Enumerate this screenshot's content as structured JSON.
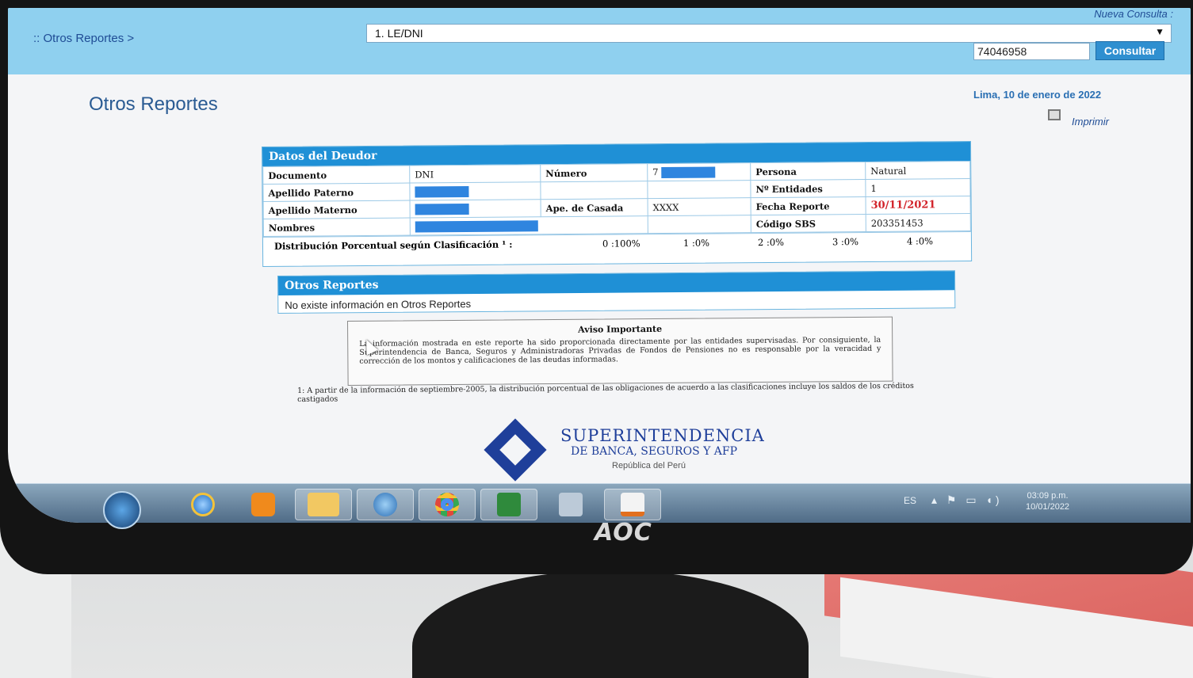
{
  "topbar": {
    "breadcrumb": ":: Otros Reportes >",
    "nueva_consulta": "Nueva Consulta :",
    "document_type": "1. LE/DNI",
    "document_number": "74046958",
    "consultar_label": "Consultar"
  },
  "page": {
    "title": "Otros Reportes",
    "date": "Lima, 10 de enero de 2022",
    "print_label": "Imprimir"
  },
  "deudor": {
    "header": "Datos del Deudor",
    "labels": {
      "documento": "Documento",
      "numero": "Número",
      "persona": "Persona",
      "entidades": "Nº Entidades",
      "apellido_paterno": "Apellido Paterno",
      "apellido_materno": "Apellido Materno",
      "ape_casada": "Ape. de Casada",
      "fecha_reporte": "Fecha Reporte",
      "nombres": "Nombres",
      "codigo_sbs": "Código SBS",
      "distribucion": "Distribución Porcentual según Clasificación ¹ :"
    },
    "values": {
      "documento": "DNI",
      "numero": "7",
      "persona": "Natural",
      "entidades": "1",
      "ape_casada": "XXXX",
      "fecha_reporte": "30/11/2021",
      "codigo_sbs": "203351453"
    },
    "distribucion": [
      "0 :100%",
      "1 :0%",
      "2 :0%",
      "3 :0%",
      "4 :0%"
    ]
  },
  "otros_reportes": {
    "header": "Otros Reportes",
    "message": "No existe información en Otros Reportes"
  },
  "aviso": {
    "title": "Aviso Importante",
    "body": "La información mostrada en este reporte ha sido proporcionada directamente por las entidades supervisadas. Por consiguiente, la Superintendencia de Banca, Seguros y Administradoras Privadas de Fondos de Pensiones no es responsable por la veracidad y corrección de los montos y calificaciones de las deudas informadas."
  },
  "footnote": "1: A partir de la información de septiembre-2005, la distribución porcentual de las obligaciones de acuerdo a las clasificaciones incluye los saldos de los créditos castigados",
  "sbs_logo": {
    "name": "SUPERINTENDENCIA",
    "subtitle": "DE BANCA, SEGUROS Y AFP",
    "country": "República del Perú"
  },
  "taskbar": {
    "lang": "ES",
    "time": "03:09 p.m.",
    "date": "10/01/2022",
    "items": [
      "start-orb-icon",
      "internet-explorer-icon",
      "media-player-icon",
      "folder-icon",
      "thunderbird-icon",
      "chrome-icon",
      "spreadsheet-icon",
      "calculator-icon",
      "java-icon"
    ]
  },
  "monitor_brand": "AOC"
}
